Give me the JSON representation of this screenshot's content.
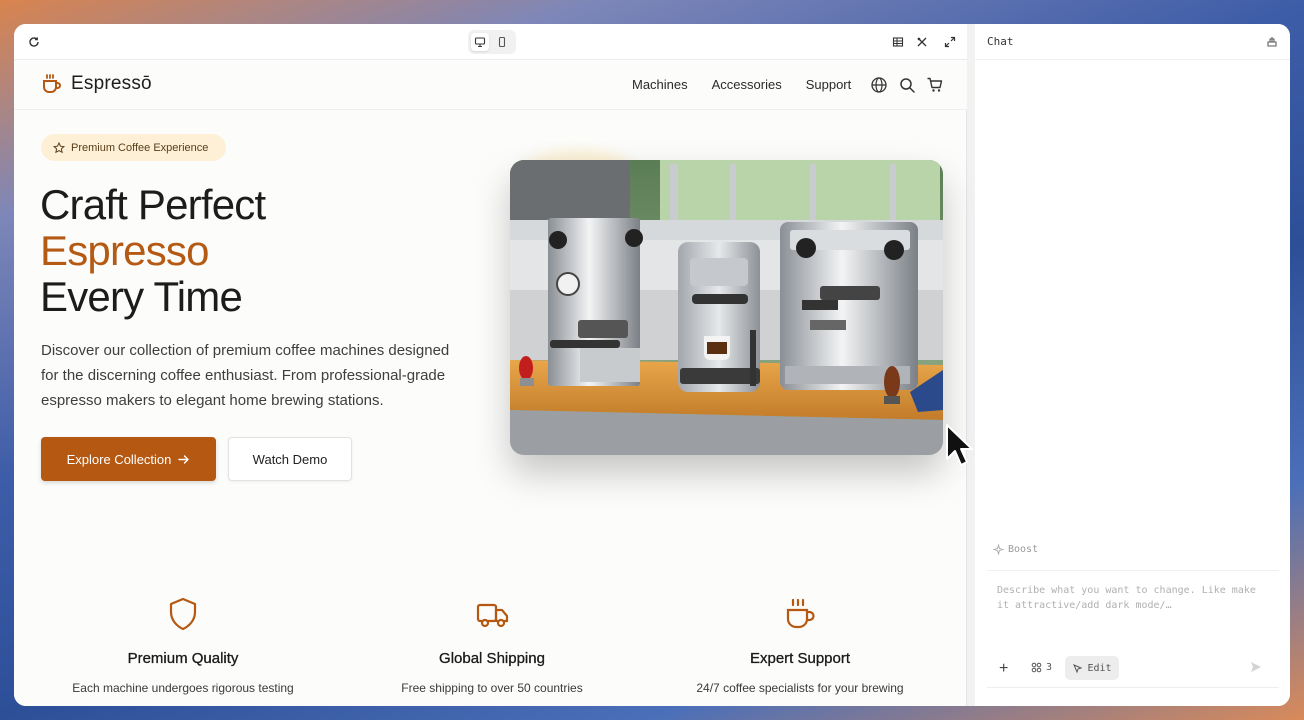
{
  "toolbar": {
    "refresh_icon": "refresh-icon",
    "device_options": [
      "desktop",
      "mobile"
    ],
    "selected_device": "desktop"
  },
  "site": {
    "logo_text": "Espressō",
    "nav": [
      "Machines",
      "Accessories",
      "Support"
    ],
    "header_icons": [
      "globe-icon",
      "search-icon",
      "cart-icon"
    ]
  },
  "hero": {
    "badge": "Premium Coffee Experience",
    "title_line1": "Craft Perfect",
    "title_accent": "Espresso",
    "title_line3": "Every Time",
    "description": "Discover our collection of premium coffee machines designed for the discerning coffee enthusiast. From professional-grade espresso makers to elegant home brewing stations.",
    "primary_button": "Explore Collection",
    "secondary_button": "Watch Demo"
  },
  "features": [
    {
      "icon": "shield-icon",
      "title": "Premium Quality",
      "text": "Each machine undergoes rigorous testing"
    },
    {
      "icon": "truck-icon",
      "title": "Global Shipping",
      "text": "Free shipping to over 50 countries"
    },
    {
      "icon": "coffee-cup-icon",
      "title": "Expert Support",
      "text": "24/7 coffee specialists for your brewing"
    }
  ],
  "chat": {
    "title": "Chat",
    "boost_label": "Boost",
    "input_placeholder": "Describe what you want to change. Like make it attractive/add dark mode/…",
    "attachment_count": "3",
    "edit_label": "Edit"
  },
  "colors": {
    "accent": "#b55812",
    "badge_bg": "#fdf0d7",
    "text": "#1c1c1c"
  }
}
